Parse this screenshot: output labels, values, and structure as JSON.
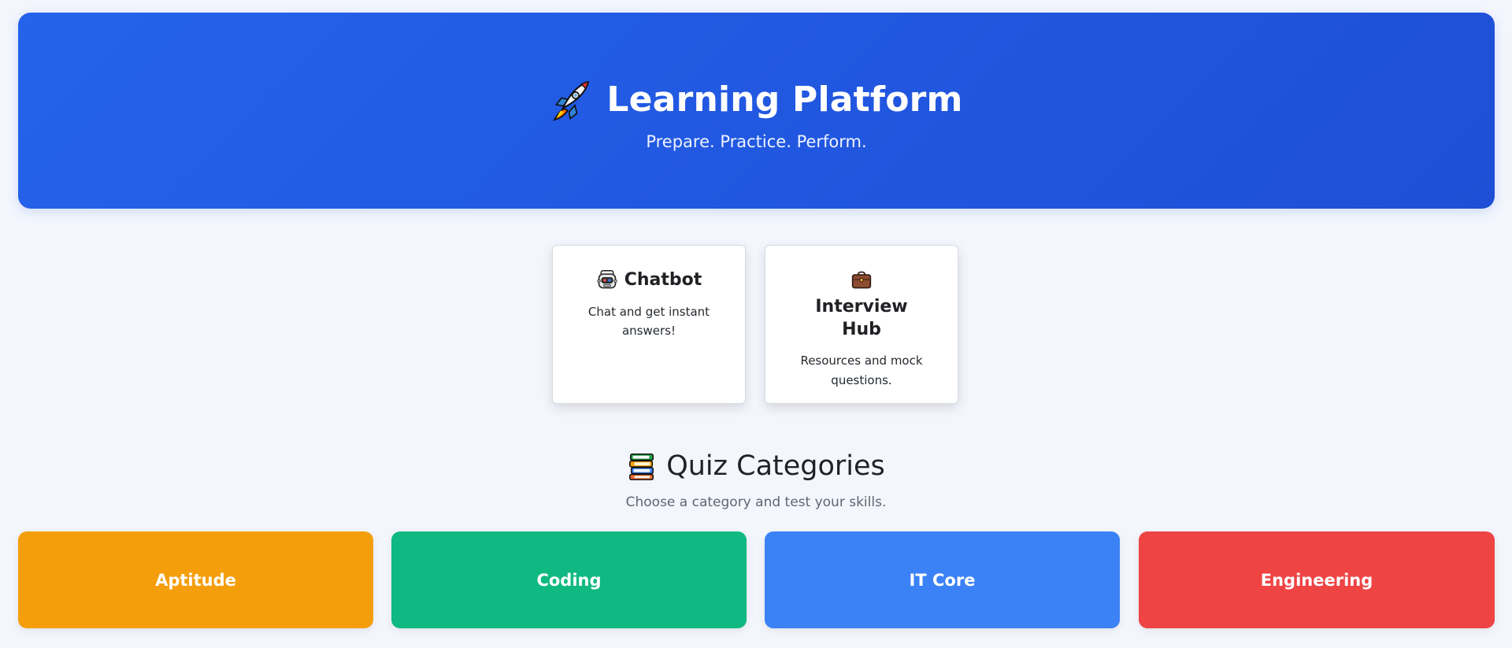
{
  "hero": {
    "title": "Learning Platform",
    "subtitle": "Prepare. Practice. Perform.",
    "icon": "rocket-icon"
  },
  "features": [
    {
      "title": "Chatbot",
      "description": "Chat and get instant answers!",
      "icon": "robot-icon"
    },
    {
      "title": "Interview Hub",
      "description": "Resources and mock questions.",
      "icon": "briefcase-icon"
    }
  ],
  "quiz": {
    "title": "Quiz Categories",
    "subtitle": "Choose a category and test your skills.",
    "icon": "books-icon",
    "categories": [
      {
        "label": "Aptitude",
        "color": "#f59e0b"
      },
      {
        "label": "Coding",
        "color": "#10b981"
      },
      {
        "label": "IT Core",
        "color": "#3b82f6"
      },
      {
        "label": "Engineering",
        "color": "#ef4444"
      }
    ]
  },
  "colors": {
    "hero_start": "#2563eb",
    "hero_end": "#1e4fd6",
    "background": "#f3f6fc",
    "card_background": "#ffffff"
  }
}
